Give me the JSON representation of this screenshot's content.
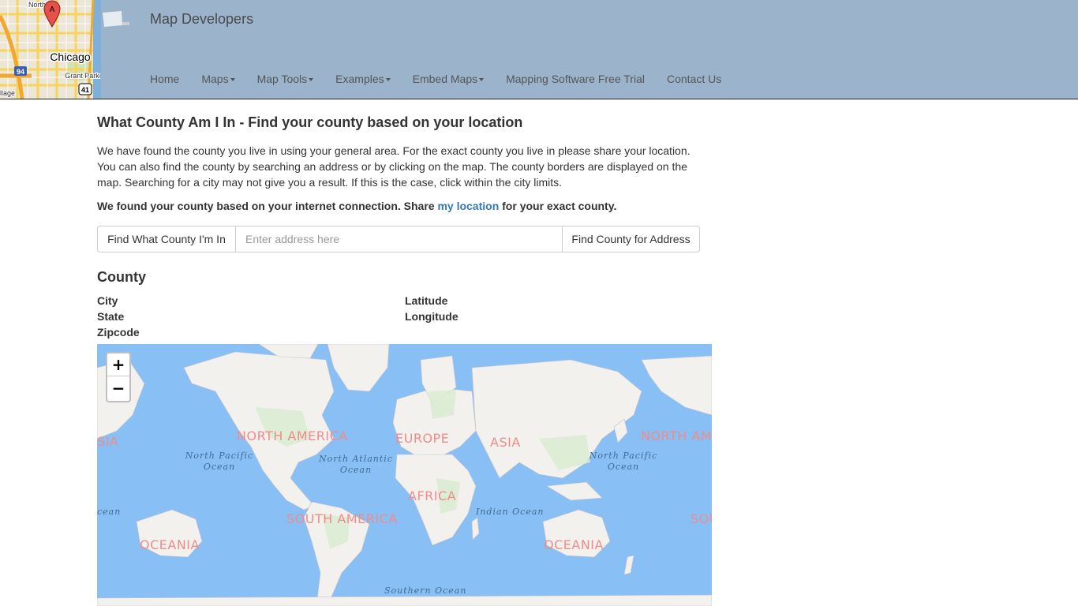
{
  "header": {
    "brand": "Map Developers",
    "logo_labels": {
      "city": "Chicago",
      "park": "Grant Park",
      "area": "North",
      "village": "llage",
      "route94": "94",
      "route41": "41",
      "marker": "A"
    },
    "nav": [
      {
        "label": "Home",
        "has_caret": false
      },
      {
        "label": "Maps",
        "has_caret": true
      },
      {
        "label": "Map Tools",
        "has_caret": true
      },
      {
        "label": "Examples",
        "has_caret": true
      },
      {
        "label": "Embed Maps",
        "has_caret": true
      },
      {
        "label": "Mapping Software Free Trial",
        "has_caret": false
      },
      {
        "label": "Contact Us",
        "has_caret": false
      }
    ]
  },
  "main": {
    "title": "What County Am I In - Find your county based on your location",
    "intro": "We have found the county you live in using your general area. For the exact county you live in please share your location. You can also find the county by searching an address or by clicking on the map. The county borders are displayed on the map. Searching for a city may not give you a result. If this is the case, click within the city limits.",
    "found_prefix": "We found your county based on your internet connection. Share ",
    "found_link": "my location",
    "found_suffix": " for your exact county.",
    "search": {
      "locate_button": "Find What County I'm In",
      "placeholder": "Enter address here",
      "value": "",
      "submit_button": "Find County for Address"
    },
    "result": {
      "heading": "County",
      "city_label": "City",
      "state_label": "State",
      "zip_label": "Zipcode",
      "lat_label": "Latitude",
      "lng_label": "Longitude"
    }
  },
  "map": {
    "zoom_in": "+",
    "zoom_out": "−",
    "continents": [
      "SIA",
      "NORTH AMERICA",
      "EUROPE",
      "ASIA",
      "NORTH AM",
      "AFRICA",
      "SOUTH AMERICA",
      "SOU",
      "OCEANIA",
      "OCEANIA"
    ],
    "oceans": [
      "North Pacific Ocean",
      "North Atlantic Ocean",
      "North Pacific Ocean",
      "Indian Ocean",
      "Southern Ocean",
      "cean"
    ],
    "colors": {
      "water": "#88bff5",
      "land": "#f2f1ee",
      "vegetation": "#d8ecd0",
      "continent_label": "#f08c8c"
    }
  }
}
